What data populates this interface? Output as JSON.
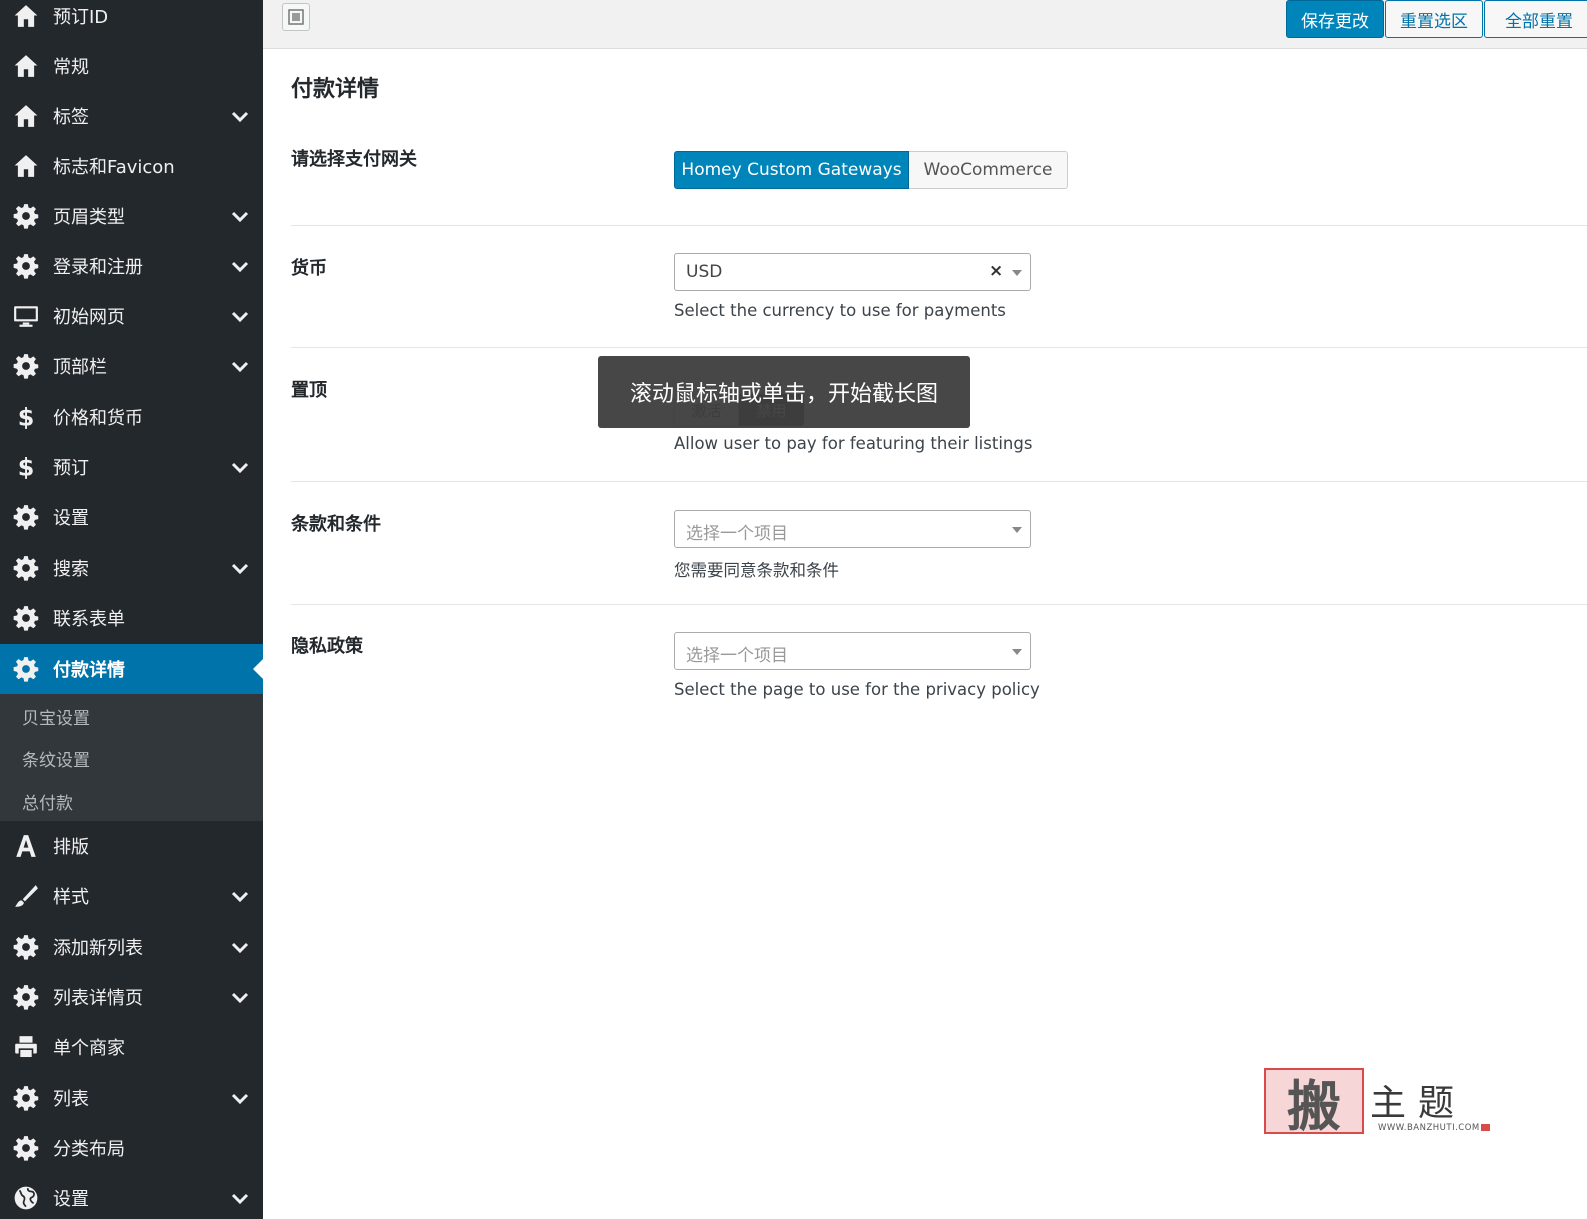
{
  "sidebar": {
    "items": [
      {
        "label": "预订ID",
        "icon": "home-icon",
        "chevron": false
      },
      {
        "label": "常规",
        "icon": "home-icon",
        "chevron": false
      },
      {
        "label": "标签",
        "icon": "home-icon",
        "chevron": true
      },
      {
        "label": "标志和Favicon",
        "icon": "home-icon",
        "chevron": false
      },
      {
        "label": "页眉类型",
        "icon": "gear-icon",
        "chevron": true
      },
      {
        "label": "登录和注册",
        "icon": "gear-icon",
        "chevron": true
      },
      {
        "label": "初始网页",
        "icon": "desktop-icon",
        "chevron": true
      },
      {
        "label": "顶部栏",
        "icon": "gear-icon",
        "chevron": true
      },
      {
        "label": "价格和货币",
        "icon": "dollar-icon",
        "chevron": false
      },
      {
        "label": "预订",
        "icon": "dollar-icon",
        "chevron": true
      },
      {
        "label": "设置",
        "icon": "gear-icon",
        "chevron": false
      },
      {
        "label": "搜索",
        "icon": "gear-icon",
        "chevron": true
      },
      {
        "label": "联系表单",
        "icon": "gear-icon",
        "chevron": false
      },
      {
        "label": "付款详情",
        "icon": "gear-icon",
        "chevron": false,
        "active": true
      },
      {
        "label": "排版",
        "icon": "font-icon",
        "chevron": false
      },
      {
        "label": "样式",
        "icon": "brush-icon",
        "chevron": true
      },
      {
        "label": "添加新列表",
        "icon": "gear-icon",
        "chevron": true
      },
      {
        "label": "列表详情页",
        "icon": "gear-icon",
        "chevron": true
      },
      {
        "label": "单个商家",
        "icon": "printer-icon",
        "chevron": false
      },
      {
        "label": "列表",
        "icon": "gear-icon",
        "chevron": true
      },
      {
        "label": "分类布局",
        "icon": "gear-icon",
        "chevron": false
      },
      {
        "label": "设置",
        "icon": "globe-icon",
        "chevron": true
      }
    ],
    "submenu": [
      "贝宝设置",
      "条纹设置",
      "总付款"
    ]
  },
  "toolbar": {
    "save_label": "保存更改",
    "reset_section_label": "重置选区",
    "reset_all_label": "全部重置"
  },
  "main": {
    "title": "付款详情",
    "gateway": {
      "label": "请选择支付网关",
      "options": [
        "Homey Custom Gateways",
        "WooCommerce"
      ],
      "selected": "Homey Custom Gateways"
    },
    "currency": {
      "label": "货币",
      "value": "USD",
      "description": "Select the currency to use for payments"
    },
    "featured": {
      "label": "置顶",
      "options": [
        "激活",
        "禁用"
      ],
      "description": "Allow user to pay for featuring their listings"
    },
    "terms": {
      "label": "条款和条件",
      "placeholder": "选择一个项目",
      "description": "您需要同意条款和条件"
    },
    "privacy": {
      "label": "隐私政策",
      "placeholder": "选择一个项目",
      "description": "Select the page to use for the privacy policy"
    }
  },
  "tooltip": "滚动鼠标轴或单击，开始截长图",
  "watermark": {
    "seal_char": "搬",
    "text": "主题",
    "url": "WWW.BANZHUTI.COM"
  },
  "colors": {
    "sidebar_bg": "#23282d",
    "active_bg": "#0073aa",
    "primary_button": "#0085ba"
  }
}
